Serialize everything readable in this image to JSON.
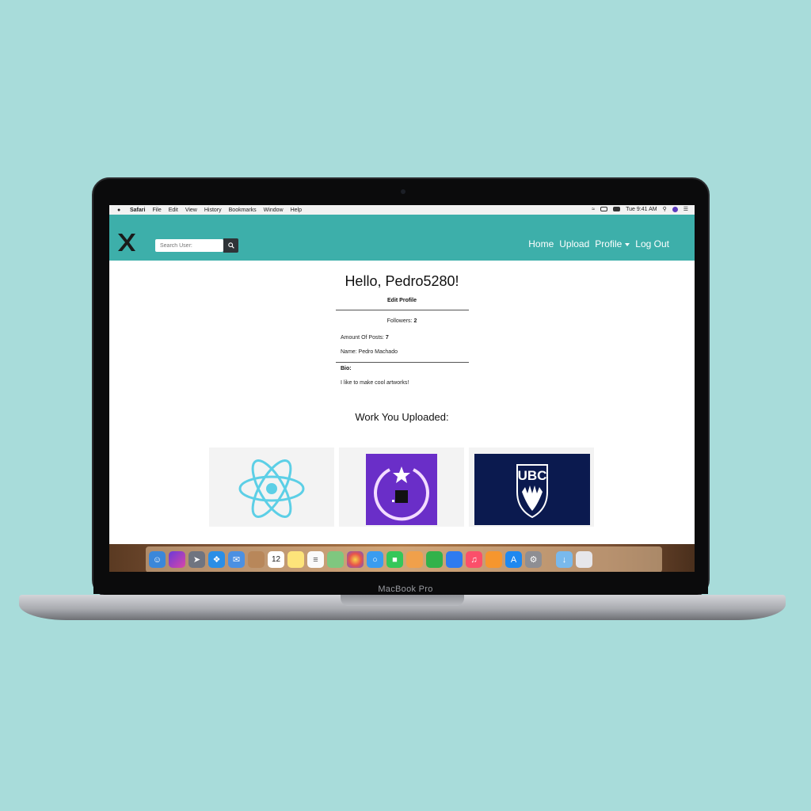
{
  "device": {
    "brand_label": "MacBook Pro"
  },
  "menubar": {
    "items": [
      "Safari",
      "File",
      "Edit",
      "View",
      "History",
      "Bookmarks",
      "Window",
      "Help"
    ],
    "clock": "Tue 9:41 AM"
  },
  "navbar": {
    "logo_icon": "x-logo-icon",
    "search_placeholder": "Search User:",
    "links": {
      "home": "Home",
      "upload": "Upload",
      "profile": "Profile",
      "logout": "Log Out"
    }
  },
  "profile": {
    "greeting": "Hello, Pedro5280!",
    "edit_label": "Edit Profile",
    "followers_label": "Followers:",
    "followers_count": "2",
    "posts_label": "Amount Of Posts:",
    "posts_count": "7",
    "name_text": "Name: Pedro Machado",
    "bio_heading": "Bio:",
    "bio_text": "I like to make cool artworks!"
  },
  "uploads": {
    "heading": "Work You Uploaded:",
    "items": [
      {
        "icon": "react-logo-icon"
      },
      {
        "icon": "star-circle-icon"
      },
      {
        "icon": "ubc-logo-icon",
        "text": "UBC"
      }
    ]
  },
  "dock": {
    "calendar_day": "12",
    "apps": [
      "finder-icon",
      "siri-icon",
      "launchpad-icon",
      "safari-icon",
      "mail-icon",
      "contacts-icon",
      "calendar-icon",
      "notes-icon",
      "reminders-icon",
      "maps-icon",
      "photos-icon",
      "messages-icon",
      "facetime-icon",
      "pages-icon",
      "numbers-icon",
      "keynote-icon",
      "music-icon",
      "books-icon",
      "app-store-icon",
      "system-preferences-icon",
      "downloads-folder-icon",
      "trash-icon"
    ]
  },
  "colors": {
    "nav": "#3dafaa",
    "background": "#a8dcda"
  }
}
